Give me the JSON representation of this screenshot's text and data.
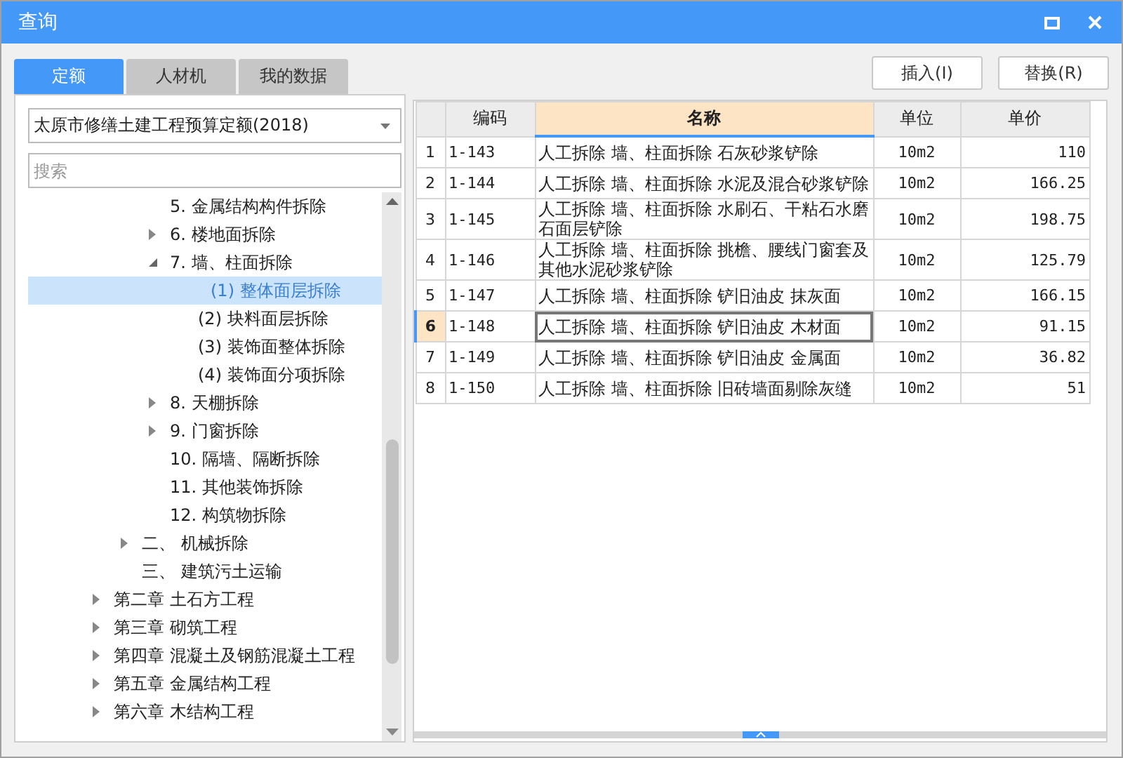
{
  "window": {
    "title": "查询"
  },
  "tabs": [
    {
      "label": "定额",
      "selected": true
    },
    {
      "label": "人材机",
      "selected": false
    },
    {
      "label": "我的数据",
      "selected": false
    }
  ],
  "library_select": {
    "value": "太原市修缮土建工程预算定额(2018)"
  },
  "search": {
    "placeholder": "搜索"
  },
  "tree": [
    {
      "children": [
        {
          "children": [
            {
              "label": "5. 金属结构构件拆除",
              "selected": false,
              "expandable": false
            },
            {
              "label": "6. 楼地面拆除",
              "selected": false,
              "expandable": true,
              "expanded": false
            },
            {
              "label": "7. 墙、柱面拆除",
              "selected": false,
              "expandable": true,
              "expanded": true,
              "children": [
                {
                  "label": "(1) 整体面层拆除",
                  "selected": true,
                  "expandable": false
                },
                {
                  "label": "(2) 块料面层拆除",
                  "selected": false,
                  "expandable": false
                },
                {
                  "label": "(3) 装饰面整体拆除",
                  "selected": false,
                  "expandable": false
                },
                {
                  "label": "(4) 装饰面分项拆除",
                  "selected": false,
                  "expandable": false
                }
              ]
            },
            {
              "label": "8. 天棚拆除",
              "selected": false,
              "expandable": true,
              "expanded": false
            },
            {
              "label": "9. 门窗拆除",
              "selected": false,
              "expandable": true,
              "expanded": false
            },
            {
              "label": "10. 隔墙、隔断拆除",
              "selected": false,
              "expandable": false
            },
            {
              "label": "11. 其他装饰拆除",
              "selected": false,
              "expandable": false
            },
            {
              "label": "12. 构筑物拆除",
              "selected": false,
              "expandable": false
            }
          ]
        },
        {
          "label": "二、  机械拆除",
          "selected": false,
          "expandable": true,
          "expanded": false
        },
        {
          "label": "三、  建筑污土运输",
          "selected": false,
          "expandable": false
        }
      ]
    },
    {
      "label": "第二章 土石方工程",
      "selected": false,
      "expandable": true,
      "expanded": false
    },
    {
      "label": "第三章 砌筑工程",
      "selected": false,
      "expandable": true,
      "expanded": false
    },
    {
      "label": "第四章 混凝土及钢筋混凝土工程",
      "selected": false,
      "expandable": true,
      "expanded": false
    },
    {
      "label": "第五章 金属结构工程",
      "selected": false,
      "expandable": true,
      "expanded": false
    },
    {
      "label": "第六章 木结构工程",
      "selected": false,
      "expandable": true,
      "expanded": false
    }
  ],
  "buttons": [
    {
      "label": "插入(I)"
    },
    {
      "label": "替换(R)"
    }
  ],
  "table": {
    "columns": [
      {
        "label": "编码",
        "selected": false
      },
      {
        "label": "名称",
        "selected": true
      },
      {
        "label": "单位",
        "selected": false
      },
      {
        "label": "单价",
        "selected": false
      }
    ],
    "rows": [
      {
        "index": "1",
        "code": "1-143",
        "name": "人工拆除 墙、柱面拆除 石灰砂浆铲除",
        "unit": "10m2",
        "price": "110",
        "selected": false
      },
      {
        "index": "2",
        "code": "1-144",
        "name": "人工拆除 墙、柱面拆除 水泥及混合砂浆铲除",
        "unit": "10m2",
        "price": "166.25",
        "selected": false
      },
      {
        "index": "3",
        "code": "1-145",
        "name": "人工拆除 墙、柱面拆除 水刷石、干粘石水磨石面层铲除",
        "unit": "10m2",
        "price": "198.75",
        "selected": false
      },
      {
        "index": "4",
        "code": "1-146",
        "name": "人工拆除 墙、柱面拆除 挑檐、腰线门窗套及其他水泥砂浆铲除",
        "unit": "10m2",
        "price": "125.79",
        "selected": false
      },
      {
        "index": "5",
        "code": "1-147",
        "name": "人工拆除 墙、柱面拆除 铲旧油皮 抹灰面",
        "unit": "10m2",
        "price": "166.15",
        "selected": false
      },
      {
        "index": "6",
        "code": "1-148",
        "name": "人工拆除 墙、柱面拆除 铲旧油皮 木材面",
        "unit": "10m2",
        "price": "91.15",
        "selected": true
      },
      {
        "index": "7",
        "code": "1-149",
        "name": "人工拆除 墙、柱面拆除 铲旧油皮 金属面",
        "unit": "10m2",
        "price": "36.82",
        "selected": false
      },
      {
        "index": "8",
        "code": "1-150",
        "name": "人工拆除 墙、柱面拆除 旧砖墙面剔除灰缝",
        "unit": "10m2",
        "price": "51",
        "selected": false
      }
    ]
  }
}
